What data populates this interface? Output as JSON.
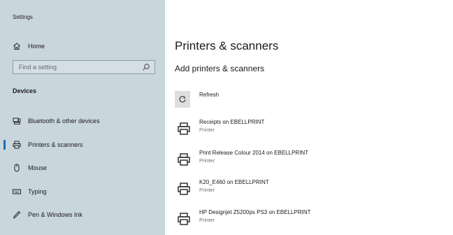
{
  "app": {
    "title": "Settings"
  },
  "sidebar": {
    "home": {
      "label": "Home",
      "icon": "home-icon"
    },
    "search": {
      "placeholder": "Find a setting",
      "icon": "search-icon"
    },
    "section": "Devices",
    "items": [
      {
        "label": "Bluetooth & other devices",
        "icon": "bluetooth-devices-icon",
        "selected": false
      },
      {
        "label": "Printers & scanners",
        "icon": "printer-icon",
        "selected": true
      },
      {
        "label": "Mouse",
        "icon": "mouse-icon",
        "selected": false
      },
      {
        "label": "Typing",
        "icon": "keyboard-icon",
        "selected": false
      },
      {
        "label": "Pen & Windows Ink",
        "icon": "pen-icon",
        "selected": false
      }
    ]
  },
  "main": {
    "title": "Printers & scanners",
    "subtitle": "Add printers & scanners",
    "refresh_label": "Refresh",
    "printers": [
      {
        "name": "Receipts on EBELLPRINT",
        "type": "Printer"
      },
      {
        "name": "Print Release Colour 2014 on EBELLPRINT",
        "type": "Printer"
      },
      {
        "name": "K20_E460 on EBELLPRINT",
        "type": "Printer"
      },
      {
        "name": "HP Designjet Z5200ps PS3 on EBELLPRINT",
        "type": "Printer"
      }
    ]
  },
  "colors": {
    "sidebar_bg": "#c9d6de",
    "accent": "#1a6fb5",
    "button_bg": "#dedede"
  }
}
